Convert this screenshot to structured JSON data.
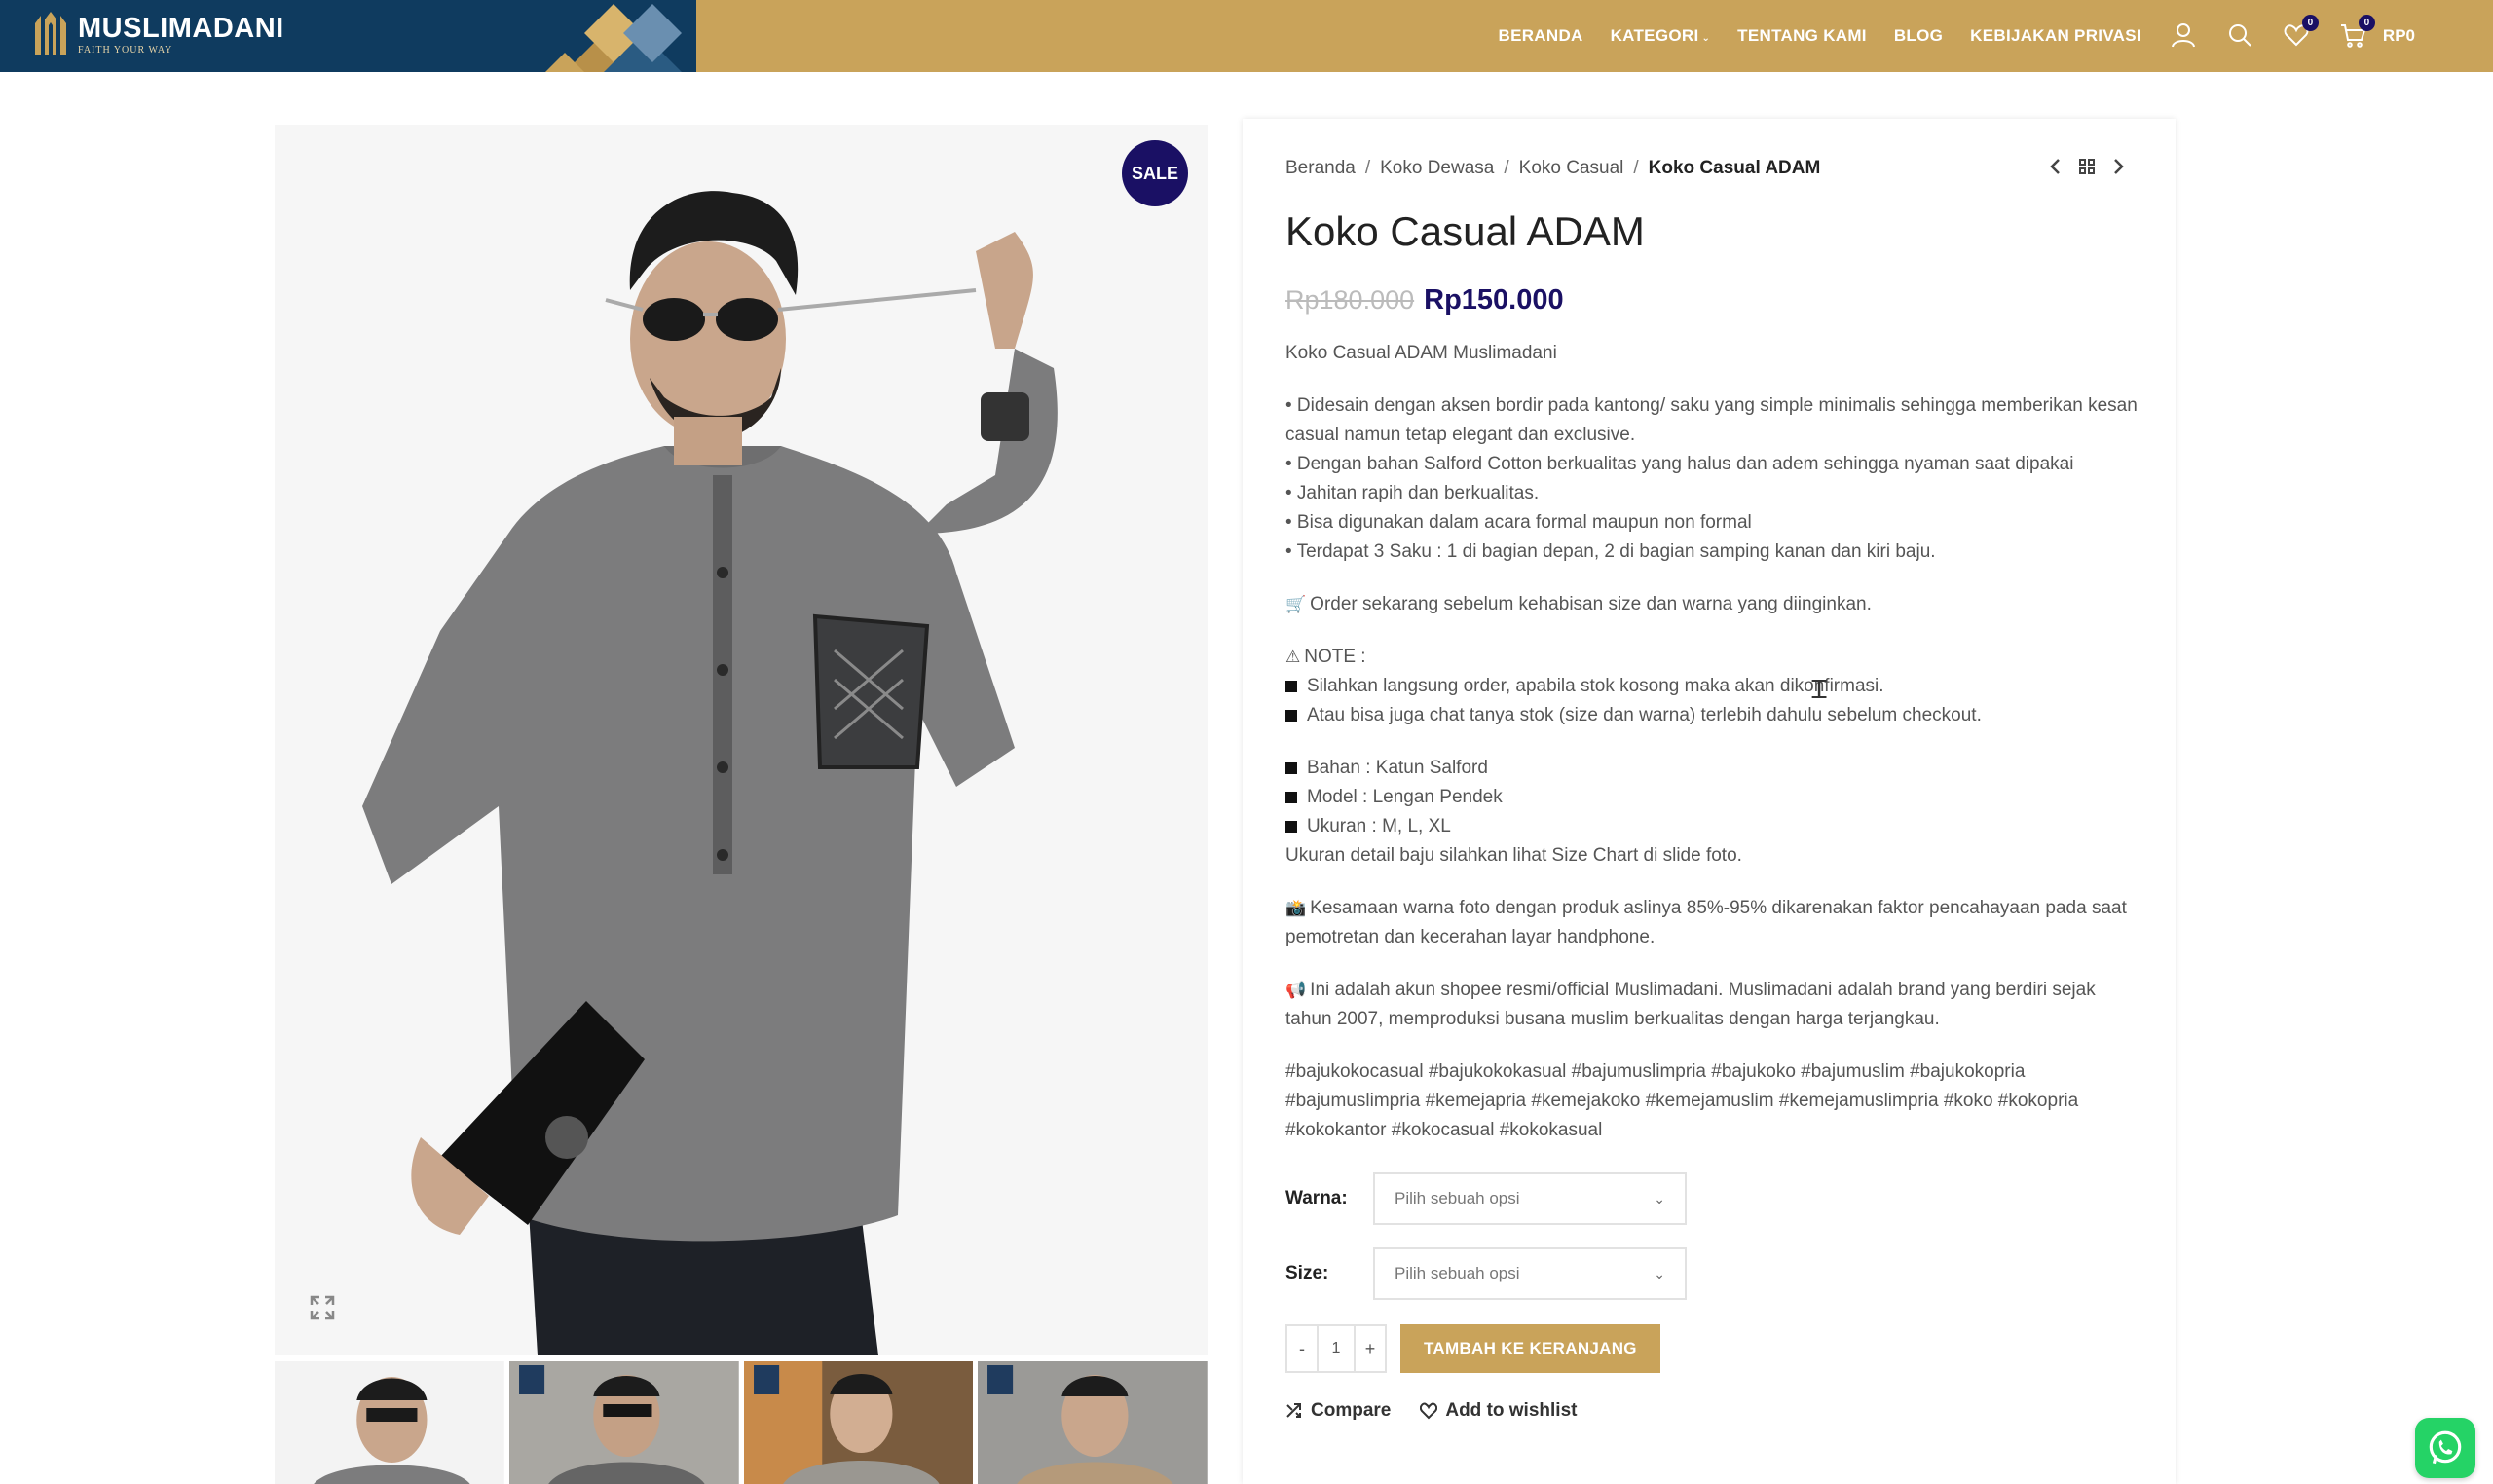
{
  "header": {
    "logo_title": "MUSLIMADANI",
    "logo_tagline": "FAITH YOUR WAY",
    "nav": [
      "BERANDA",
      "KATEGORI",
      "TENTANG KAMI",
      "BLOG",
      "KEBIJAKAN PRIVASI"
    ],
    "wishlist_count": "0",
    "cart_count": "0",
    "cart_total": "RP0"
  },
  "gallery": {
    "sale_badge": "SALE",
    "thumbnail_count": 4
  },
  "breadcrumb": [
    "Beranda",
    "Koko Dewasa",
    "Koko Casual",
    "Koko Casual ADAM"
  ],
  "product": {
    "title": "Koko Casual ADAM",
    "price_old": "Rp180.000",
    "price_new": "Rp150.000",
    "intro": "Koko Casual ADAM Muslimadani",
    "features": [
      "• Didesain dengan aksen bordir pada kantong/ saku yang simple minimalis sehingga memberikan kesan casual namun tetap elegant dan exclusive.",
      "• Dengan bahan Salford Cotton berkualitas yang halus dan adem sehingga nyaman saat dipakai",
      "• Jahitan rapih dan berkualitas.",
      "• Bisa digunakan dalam acara formal maupun non formal",
      "• Terdapat 3 Saku : 1 di bagian depan, 2 di bagian samping kanan dan kiri baju."
    ],
    "order_note": "Order sekarang sebelum kehabisan size dan warna yang diinginkan.",
    "note_title": "NOTE :",
    "notes": [
      "Silahkan langsung order, apabila stok kosong maka akan dikonfirmasi.",
      "Atau bisa juga chat tanya stok (size dan warna) terlebih dahulu sebelum checkout."
    ],
    "specs": [
      "Bahan : Katun Salford",
      "Model : Lengan Pendek",
      "Ukuran : M, L, XL"
    ],
    "size_chart_note": "Ukuran detail baju silahkan lihat Size Chart di slide foto.",
    "color_note": "Kesamaan warna foto dengan produk aslinya 85%-95% dikarenakan faktor pencahayaan pada saat pemotretan dan kecerahan layar handphone.",
    "official_note": "Ini adalah akun shopee resmi/official Muslimadani. Muslimadani adalah brand yang berdiri sejak tahun 2007, memproduksi busana muslim berkualitas dengan harga terjangkau.",
    "hashtags": "#bajukokocasual #bajukokokasual #bajumuslimpria #bajukoko #bajumuslim #bajukokopria #bajumuslimpria #kemejapria #kemejakoko #kemejamuslim #kemejamuslimpria #koko #kokopria #kokokantor #kokocasual #kokokasual"
  },
  "options": {
    "warna_label": "Warna",
    "warna_value": "Pilih sebuah opsi",
    "size_label": "Size",
    "size_value": "Pilih sebuah opsi"
  },
  "cart": {
    "minus": "-",
    "quantity": "1",
    "plus": "+",
    "add_label": "TAMBAH KE KERANJANG",
    "compare_label": "Compare",
    "wishlist_label": "Add to wishlist"
  },
  "colors": {
    "header_gold": "#c9a35a",
    "header_navy": "#0f3b5f",
    "accent_navy": "#1a1064",
    "whatsapp": "#25d366"
  }
}
